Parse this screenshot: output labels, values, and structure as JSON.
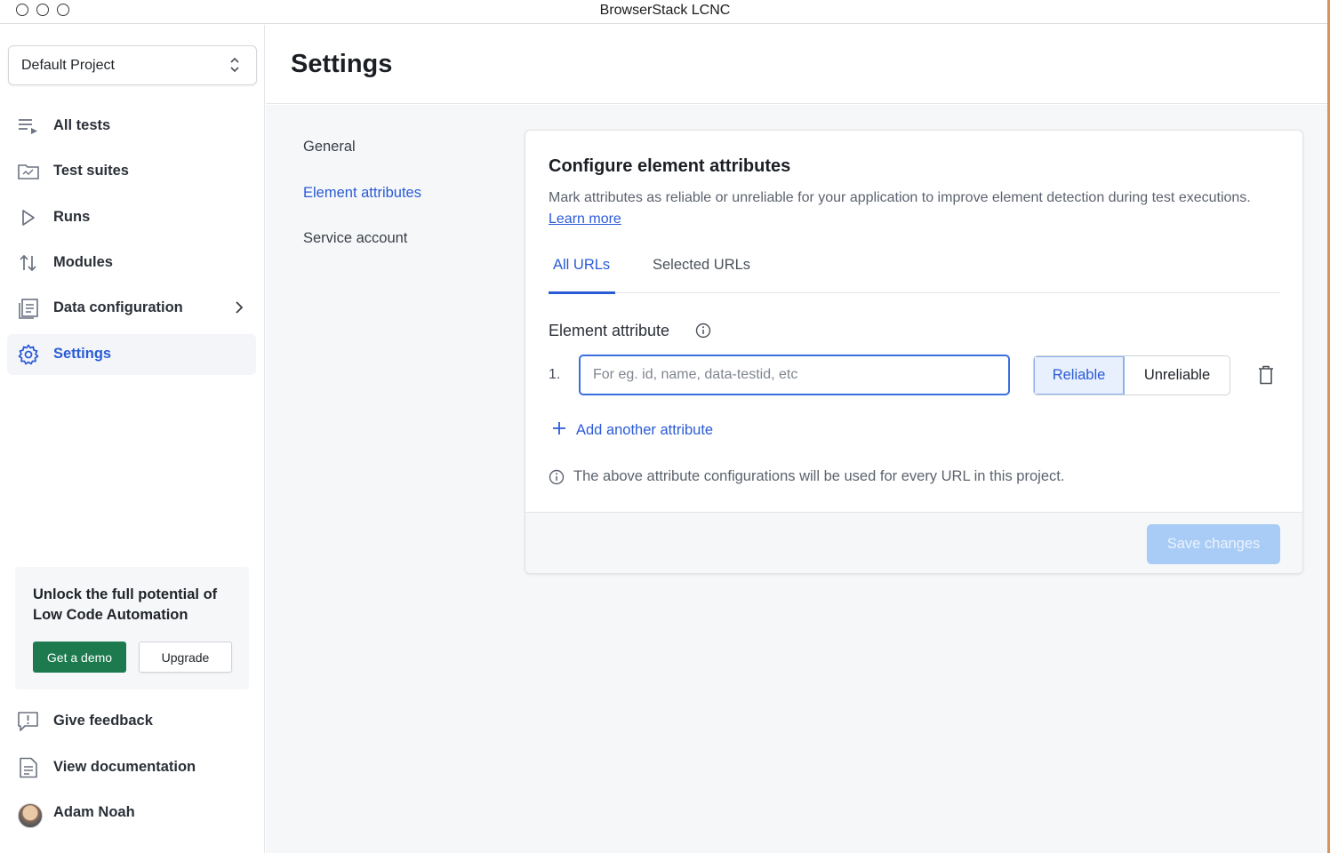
{
  "window": {
    "title": "BrowserStack LCNC"
  },
  "sidebar": {
    "project_selector": {
      "value": "Default Project"
    },
    "items": [
      {
        "label": "All tests",
        "icon": "list-icon"
      },
      {
        "label": "Test suites",
        "icon": "folder-icon"
      },
      {
        "label": "Runs",
        "icon": "play-icon"
      },
      {
        "label": "Modules",
        "icon": "sort-arrows-icon"
      },
      {
        "label": "Data configuration",
        "icon": "document-stack-icon"
      },
      {
        "label": "Settings",
        "icon": "gear-icon",
        "active": true
      }
    ],
    "promo": {
      "text": "Unlock the full potential of Low Code Automation",
      "demo_label": "Get a demo",
      "upgrade_label": "Upgrade"
    },
    "bottom": [
      {
        "label": "Give feedback",
        "icon": "feedback-icon"
      },
      {
        "label": "View documentation",
        "icon": "document-icon"
      },
      {
        "label": "Adam Noah",
        "icon": "avatar"
      }
    ]
  },
  "main": {
    "title": "Settings",
    "subnav": [
      {
        "label": "General"
      },
      {
        "label": "Element attributes",
        "active": true
      },
      {
        "label": "Service account"
      }
    ],
    "card": {
      "title": "Configure element attributes",
      "description": "Mark attributes as reliable or unreliable for your application to improve element detection during test executions.",
      "learn_more": "Learn more",
      "tabs": [
        {
          "label": "All URLs",
          "active": true
        },
        {
          "label": "Selected URLs"
        }
      ],
      "attribute_label": "Element attribute",
      "rows": [
        {
          "number": "1.",
          "value": "",
          "placeholder": "For eg. id, name, data-testid, etc",
          "selected": "Reliable"
        }
      ],
      "reliable_label": "Reliable",
      "unreliable_label": "Unreliable",
      "add_attribute": "Add another attribute",
      "note": "The above attribute configurations will be used for every URL in this project.",
      "save_label": "Save changes"
    }
  },
  "colors": {
    "accent": "#2a5bd7",
    "demo_button": "#1d7a4f",
    "save_disabled": "#a9ccf7"
  }
}
